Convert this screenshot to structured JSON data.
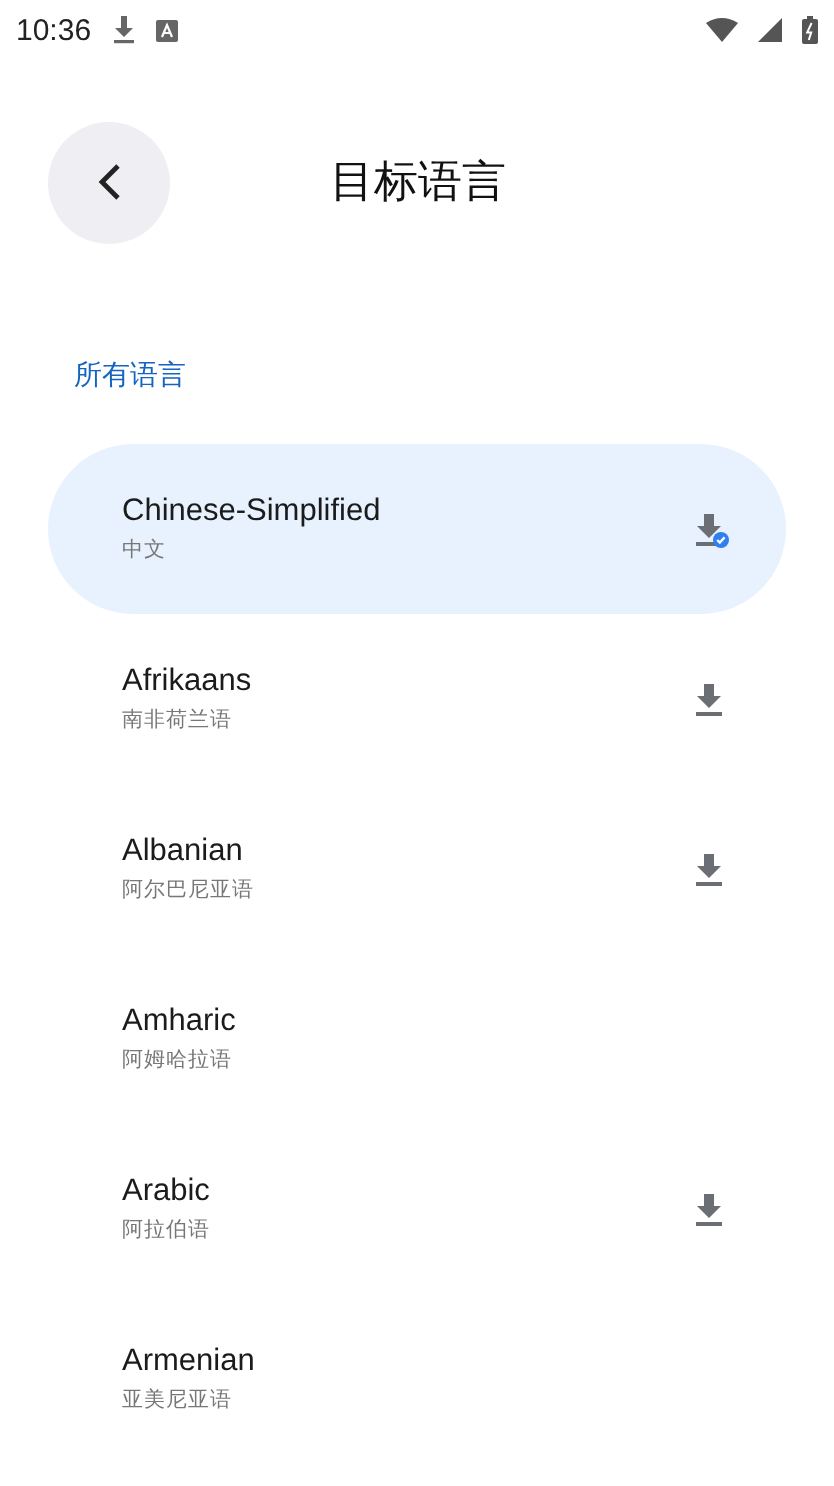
{
  "status_bar": {
    "time": "10:36"
  },
  "header": {
    "title": "目标语言"
  },
  "section": {
    "label": "所有语言"
  },
  "languages": [
    {
      "name": "Chinese-Simplified",
      "native": "中文",
      "selected": true,
      "downloadable": true,
      "downloaded": true
    },
    {
      "name": "Afrikaans",
      "native": "南非荷兰语",
      "selected": false,
      "downloadable": true,
      "downloaded": false
    },
    {
      "name": "Albanian",
      "native": "阿尔巴尼亚语",
      "selected": false,
      "downloadable": true,
      "downloaded": false
    },
    {
      "name": "Amharic",
      "native": "阿姆哈拉语",
      "selected": false,
      "downloadable": false
    },
    {
      "name": "Arabic",
      "native": "阿拉伯语",
      "selected": false,
      "downloadable": true,
      "downloaded": false
    },
    {
      "name": "Armenian",
      "native": "亚美尼亚语",
      "selected": false,
      "downloadable": false
    }
  ]
}
